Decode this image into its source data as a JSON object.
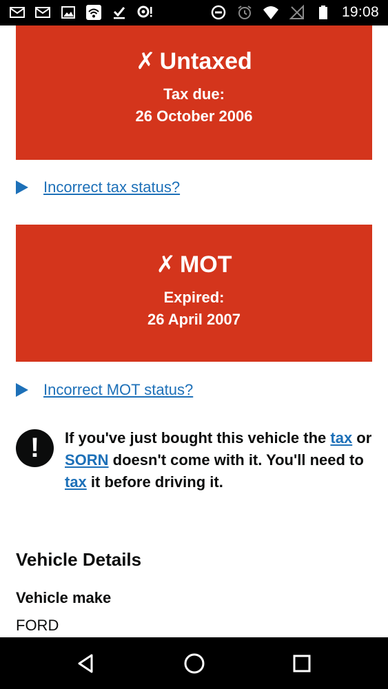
{
  "status_bar": {
    "time": "19:08",
    "left_icons": [
      "mail-icon",
      "mail-icon",
      "image-icon",
      "wifi-notification-icon",
      "download-done-icon",
      "location-alert-icon"
    ],
    "right_icons": [
      "do-not-disturb-icon",
      "alarm-icon",
      "wifi-icon",
      "no-signal-icon",
      "battery-icon"
    ]
  },
  "tax_status": {
    "heading": "Untaxed",
    "mark": "✗",
    "label": "Tax due:",
    "date": "26 October 2006",
    "link": "Incorrect tax status?"
  },
  "mot_status": {
    "heading": "MOT",
    "mark": "✗",
    "label": "Expired:",
    "date": "26 April 2007",
    "link": "Incorrect MOT status?"
  },
  "warning": {
    "icon_text": "!",
    "part1": "If you've just bought this vehicle the ",
    "link1": "tax",
    "part2": " or ",
    "link2": "SORN",
    "part3": " doesn't come with it. You'll need to ",
    "link3": "tax",
    "part4": " it before driving it."
  },
  "vehicle_details": {
    "title": "Vehicle Details",
    "make_label": "Vehicle make",
    "make_value": "FORD"
  },
  "colors": {
    "status_red": "#d4351c",
    "link_blue": "#1d70b8",
    "text_black": "#0b0c0c"
  }
}
